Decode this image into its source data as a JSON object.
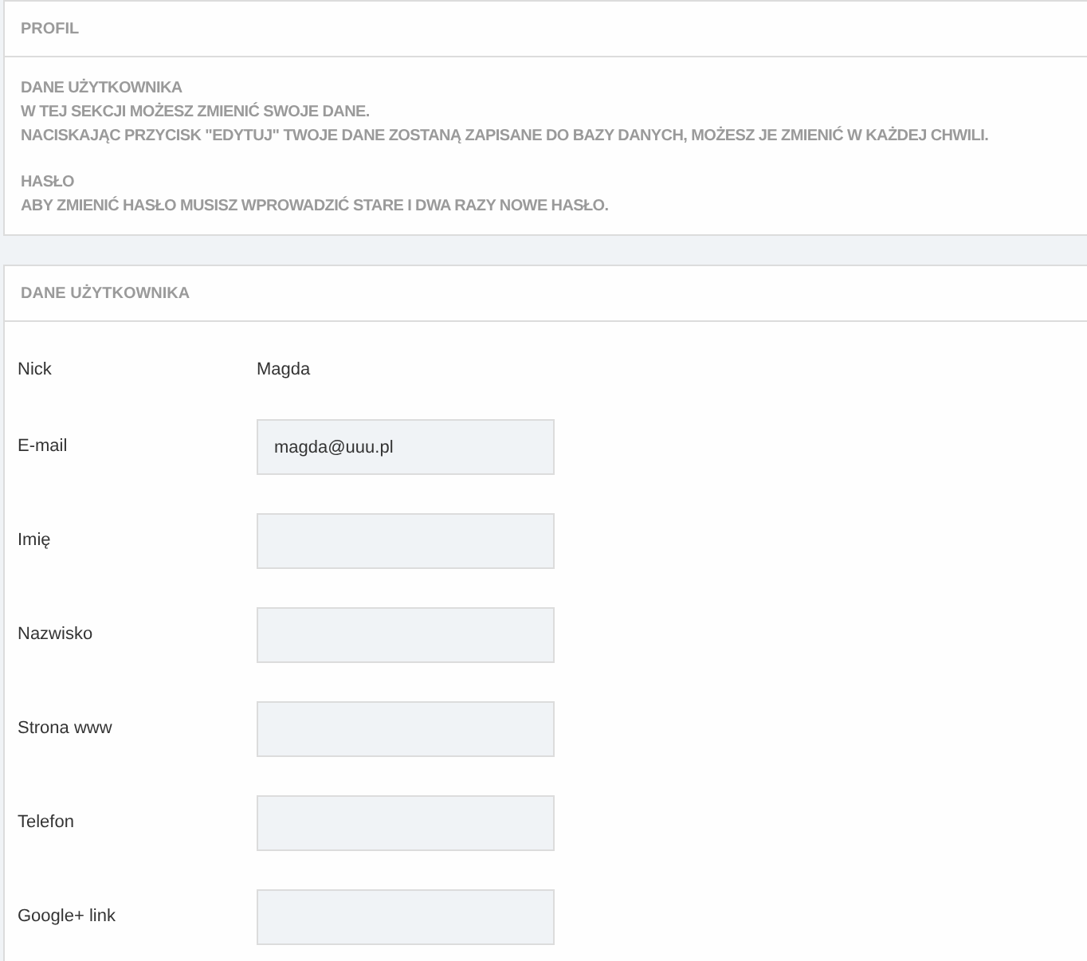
{
  "profile_panel": {
    "title": "PROFIL",
    "sections": [
      {
        "heading": "DANE UŻYTKOWNIKA",
        "lines": [
          "W TEJ SEKCJI MOŻESZ ZMIENIĆ SWOJE DANE.",
          "NACISKAJĄC PRZYCISK \"EDYTUJ\" TWOJE DANE ZOSTANĄ ZAPISANE DO BAZY DANYCH, MOŻESZ JE ZMIENIĆ W KAŻDEJ CHWILI."
        ]
      },
      {
        "heading": "HASŁO",
        "lines": [
          "ABY ZMIENIĆ HASŁO MUSISZ WPROWADZIĆ STARE I DWA RAZY NOWE HASŁO."
        ]
      }
    ]
  },
  "user_panel": {
    "title": "DANE UŻYTKOWNIKA",
    "rows": [
      {
        "label": "Nick",
        "kind": "text",
        "value": "Magda"
      },
      {
        "label": "E-mail",
        "kind": "field",
        "value": "magda@uuu.pl"
      },
      {
        "label": "Imię",
        "kind": "field"
      },
      {
        "label": "Nazwisko",
        "kind": "field"
      },
      {
        "label": "Strona www",
        "kind": "field"
      },
      {
        "label": "Telefon",
        "kind": "field"
      },
      {
        "label": "Google+ link",
        "kind": "field"
      }
    ]
  }
}
